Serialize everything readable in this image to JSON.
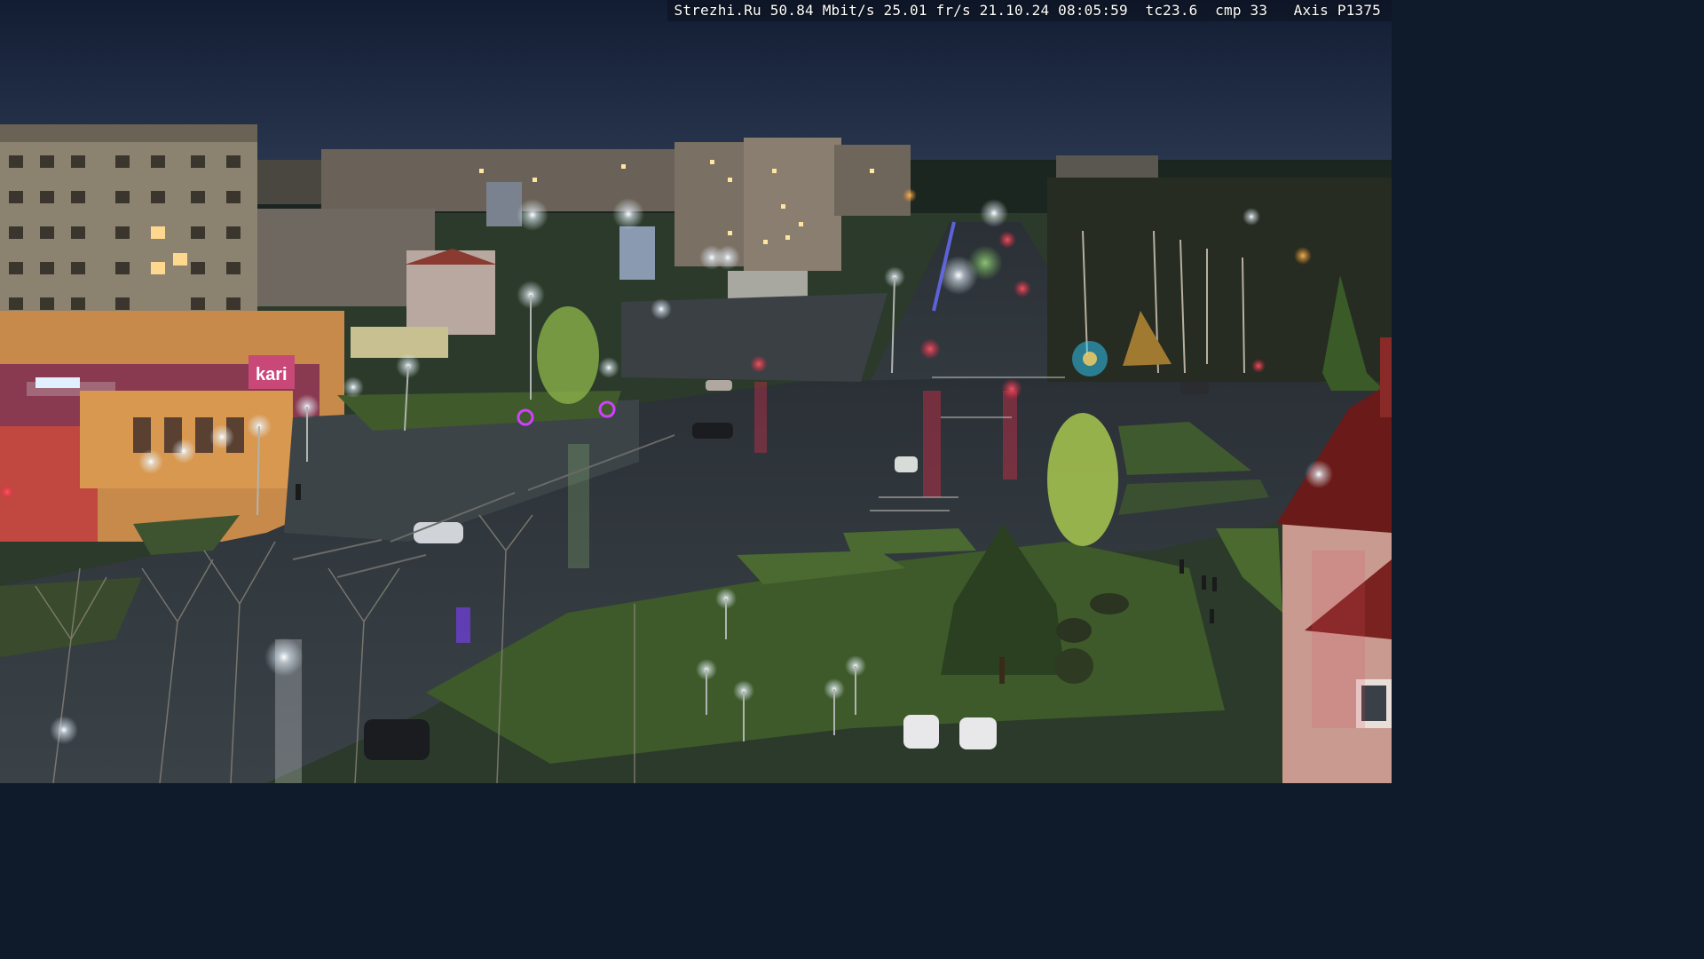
{
  "overlay": {
    "text": "Strezhi.Ru 50.84 Mbit/s 25.01 fr/s 21.10.24 08:05:59  tc23.6  cmp 33   Axis P1375"
  },
  "signs": {
    "store_logo": "kari"
  }
}
